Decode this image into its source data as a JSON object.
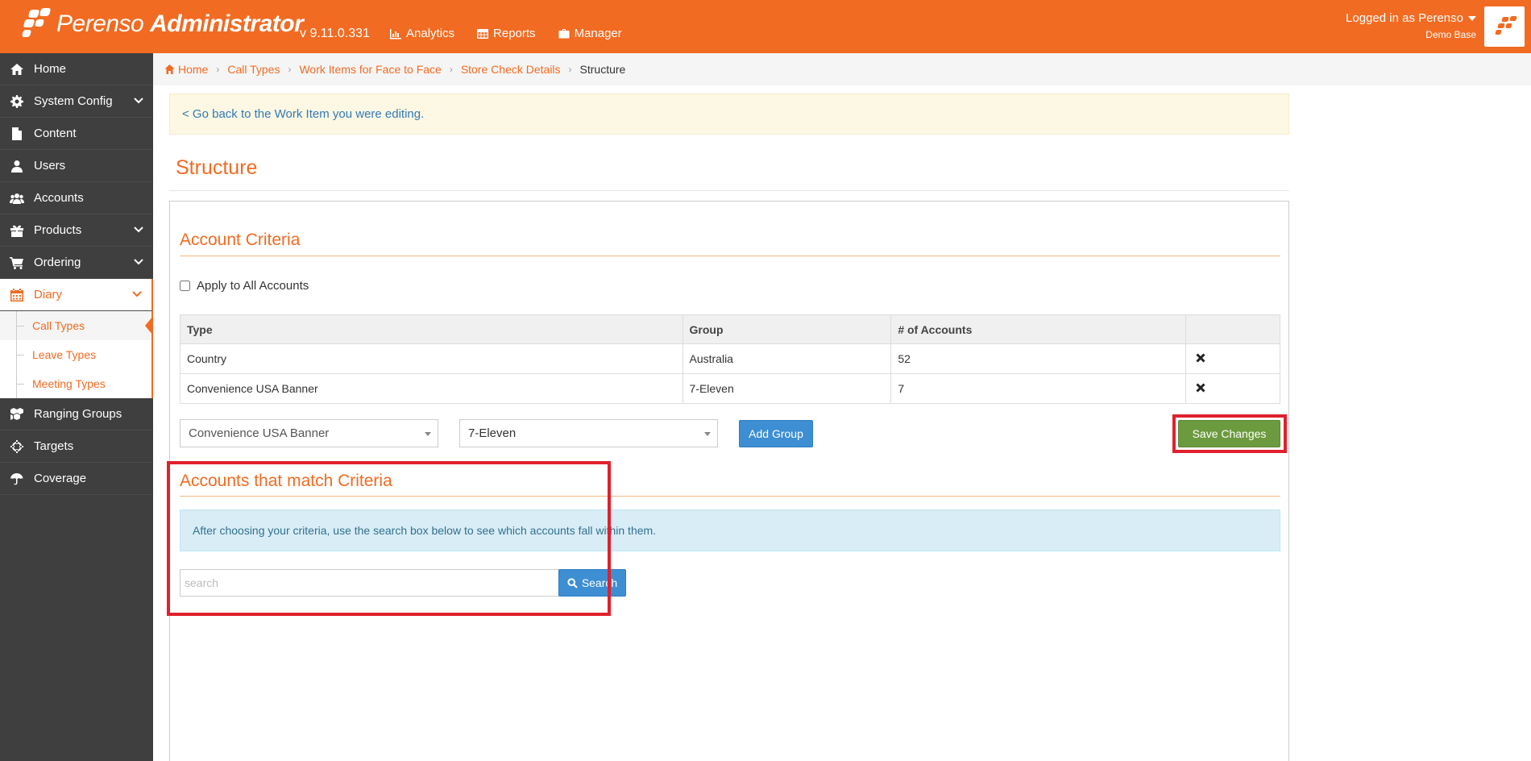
{
  "header": {
    "logo_text_light": "Perenso",
    "logo_text_bold": "Administrator",
    "version": "v 9.11.0.331",
    "nav": [
      {
        "label": "Analytics",
        "icon": "chart-icon"
      },
      {
        "label": "Reports",
        "icon": "table-icon"
      },
      {
        "label": "Manager",
        "icon": "briefcase-icon"
      }
    ],
    "user_logged": "Logged in as Perenso",
    "user_base": "Demo Base"
  },
  "sidebar": {
    "items": [
      {
        "label": "Home",
        "icon": "home-icon"
      },
      {
        "label": "System Config",
        "icon": "gear-icon"
      },
      {
        "label": "Content",
        "icon": "file-icon"
      },
      {
        "label": "Users",
        "icon": "user-icon"
      },
      {
        "label": "Accounts",
        "icon": "users-icon"
      },
      {
        "label": "Products",
        "icon": "gift-icon"
      },
      {
        "label": "Ordering",
        "icon": "cart-icon"
      },
      {
        "label": "Diary",
        "icon": "calendar-icon"
      },
      {
        "label": "Ranging Groups",
        "icon": "cubes-icon"
      },
      {
        "label": "Targets",
        "icon": "crosshairs-icon"
      },
      {
        "label": "Coverage",
        "icon": "umbrella-icon"
      }
    ],
    "diary_sub": [
      {
        "label": "Call Types"
      },
      {
        "label": "Leave Types"
      },
      {
        "label": "Meeting Types"
      }
    ]
  },
  "breadcrumb": [
    "Home",
    "Call Types",
    "Work Items for Face to Face",
    "Store Check Details",
    "Structure"
  ],
  "alert_back": "< Go back to the Work Item you were editing.",
  "page_title": "Structure",
  "account_criteria": {
    "title": "Account Criteria",
    "apply_all_label": "Apply to All Accounts",
    "columns": [
      "Type",
      "Group",
      "# of Accounts",
      ""
    ],
    "rows": [
      {
        "type": "Country",
        "group": "Australia",
        "count": "52"
      },
      {
        "type": "Convenience USA Banner",
        "group": "7-Eleven",
        "count": "7"
      }
    ],
    "type_select": "Convenience USA Banner",
    "group_select": "7-Eleven",
    "add_group_label": "Add Group",
    "save_label": "Save Changes"
  },
  "match": {
    "title": "Accounts that match Criteria",
    "info": "After choosing your criteria, use the search box below to see which accounts fall within them.",
    "search_placeholder": "search",
    "search_label": "Search"
  },
  "colors": {
    "brand": "#f26b22",
    "sidebar": "#3f3f3f",
    "highlight": "#e0202e",
    "save": "#6c9a3e",
    "primary": "#3d8ed3"
  }
}
